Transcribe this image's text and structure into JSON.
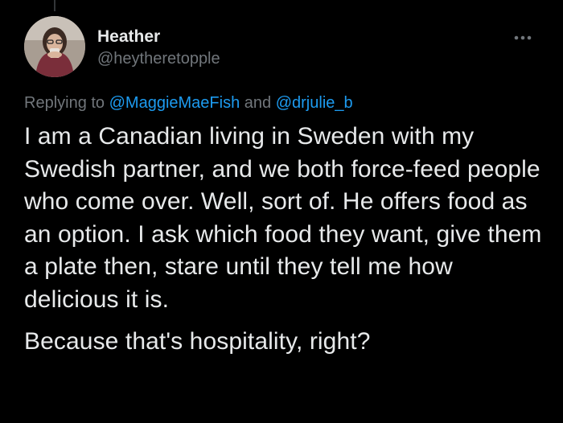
{
  "tweet": {
    "author": {
      "display_name": "Heather",
      "handle": "@heytheretopple",
      "avatar": "profile-photo"
    },
    "more_icon": "ellipsis-icon",
    "replying": {
      "prefix": "Replying to",
      "mention_1": "@MaggieMaeFish",
      "joiner": "and",
      "mention_2": "@drjulie_b"
    },
    "text": {
      "paragraph_1": "I am a Canadian living in Sweden with my Swedish partner, and we both force-feed people who come over. Well, sort of. He offers food as an option. I ask which food they want, give them a plate then, stare until they tell me how delicious it is.",
      "paragraph_2": "Because that's hospitality, right?"
    }
  },
  "colors": {
    "background": "#000000",
    "primary_text": "#e7e9ea",
    "secondary_text": "#71767b",
    "link": "#1d9bf0"
  }
}
